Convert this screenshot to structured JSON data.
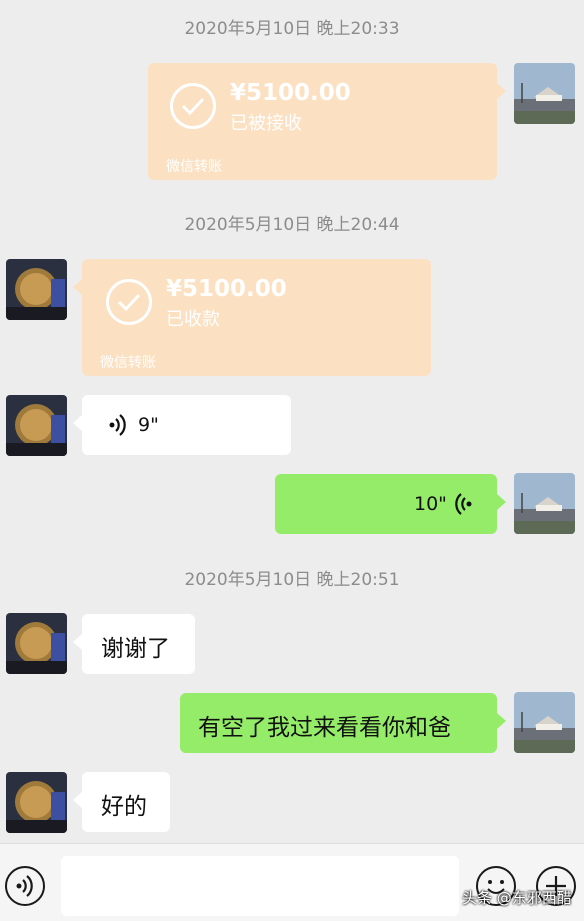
{
  "chat": {
    "timestamps": [
      "2020年5月10日 晚上20:33",
      "2020年5月10日 晚上20:44",
      "2020年5月10日 晚上20:51"
    ],
    "transfer_sent": {
      "amount": "¥5100.00",
      "status": "已被接收",
      "footer": "微信转账"
    },
    "transfer_received": {
      "amount": "¥5100.00",
      "status": "已收款",
      "footer": "微信转账"
    },
    "voice_in": {
      "duration": "9\""
    },
    "voice_out": {
      "duration": "10\""
    },
    "messages": {
      "thanks": "谢谢了",
      "visit": "有空了我过来看看你和爸",
      "ok": "好的"
    }
  },
  "watermark": "头条 @东邪西醋",
  "icons": {
    "voice": "voice-icon",
    "emoji": "emoji-icon",
    "plus": "plus-icon"
  },
  "colors": {
    "background": "#ededed",
    "green_bubble": "#95ec69",
    "white_bubble": "#ffffff",
    "transfer_bubble": "#fbe0c2"
  }
}
